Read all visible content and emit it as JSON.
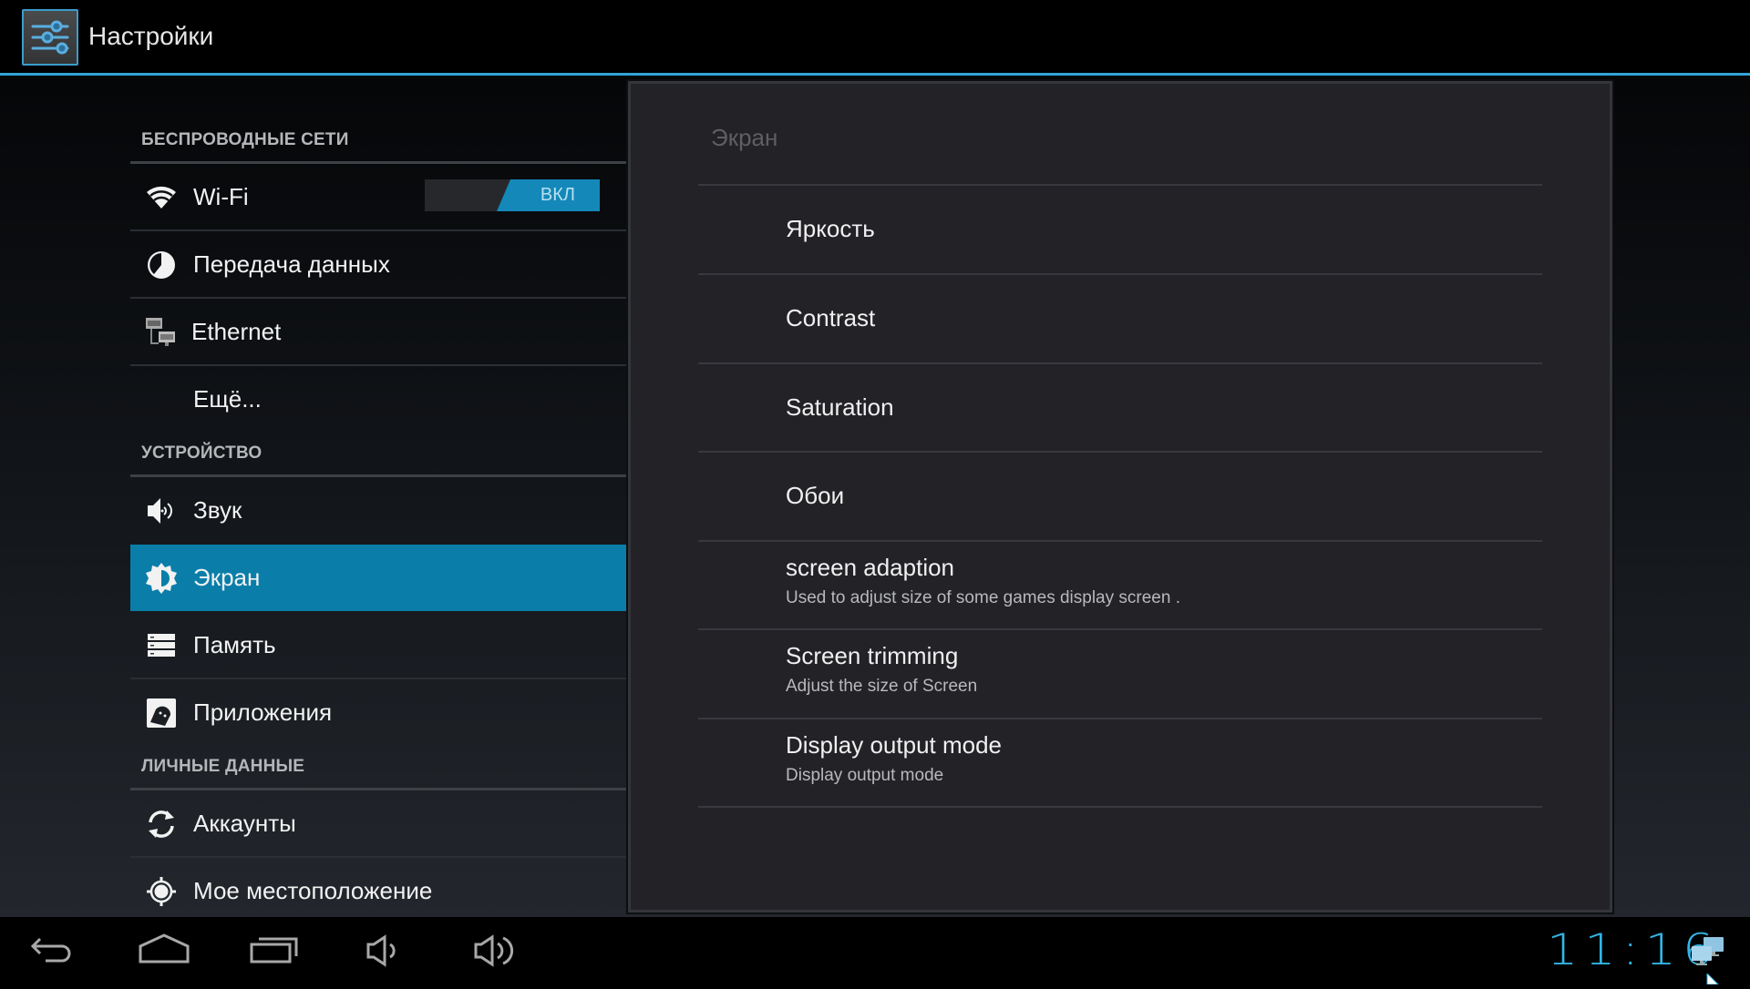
{
  "app": {
    "title": "Настройки",
    "icon": "settings-sliders-icon",
    "accent_color": "#33a4d6"
  },
  "left_list": {
    "sections": [
      {
        "header": "БЕСПРОВОДНЫЕ СЕТИ",
        "items": [
          {
            "label": "Wi-Fi",
            "icon": "wifi-icon",
            "toggle": {
              "label": "ВКЛ",
              "on": true
            }
          },
          {
            "label": "Передача данных",
            "icon": "data-usage-icon"
          },
          {
            "label": "Ethernet",
            "icon": "ethernet-icon"
          },
          {
            "label": "Ещё...",
            "icon": null
          }
        ]
      },
      {
        "header": "УСТРОЙСТВО",
        "items": [
          {
            "label": "Звук",
            "icon": "sound-icon"
          },
          {
            "label": "Экран",
            "icon": "display-brightness-icon",
            "selected": true
          },
          {
            "label": "Память",
            "icon": "storage-icon"
          },
          {
            "label": "Приложения",
            "icon": "apps-icon"
          }
        ]
      },
      {
        "header": "ЛИЧНЫЕ ДАННЫЕ",
        "items": [
          {
            "label": "Аккаунты",
            "icon": "sync-icon"
          },
          {
            "label": "Мое местоположение",
            "icon": "location-icon"
          }
        ]
      }
    ],
    "selected_color": "#0a7ea9"
  },
  "panel": {
    "title": "Экран",
    "items": [
      {
        "title": "Яркость",
        "summary": null
      },
      {
        "title": "Contrast",
        "summary": null
      },
      {
        "title": "Saturation",
        "summary": null
      },
      {
        "title": "Обои",
        "summary": null
      },
      {
        "title": "screen adaption",
        "summary": "Used to adjust size of some games display screen ."
      },
      {
        "title": "Screen trimming",
        "summary": "Adjust the size of Screen"
      },
      {
        "title": "Display output mode",
        "summary": "Display output mode"
      }
    ]
  },
  "navbar": {
    "buttons": [
      "back-icon",
      "home-icon",
      "recent-apps-icon",
      "volume-down-icon",
      "volume-up-icon"
    ],
    "clock": "11:16",
    "status_icon": "network-connected-icon",
    "clock_color": "#33b5e5"
  }
}
